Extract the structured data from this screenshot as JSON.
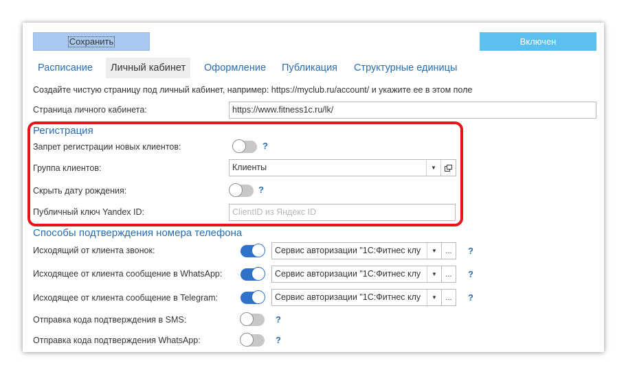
{
  "toolbar": {
    "save_label": "Сохранить",
    "status_label": "Включен"
  },
  "tabs": [
    {
      "label": "Расписание",
      "active": false
    },
    {
      "label": "Личный кабинет",
      "active": true
    },
    {
      "label": "Оформление",
      "active": false
    },
    {
      "label": "Публикация",
      "active": false
    },
    {
      "label": "Структурные единицы",
      "active": false
    }
  ],
  "note": "Создайте чистую страницу под личный кабинет, например: https://myclub.ru/account/ и укажите ее в этом поле",
  "account_page": {
    "label": "Страница личного кабинета:",
    "value": "https://www.fitness1c.ru/lk/"
  },
  "registration": {
    "title": "Регистрация",
    "ban_registration": {
      "label": "Запрет регистрации новых клиентов:",
      "on": false,
      "help": "?"
    },
    "client_group": {
      "label": "Группа клиентов:",
      "value": "Клиенты"
    },
    "hide_birthdate": {
      "label": "Скрыть дату рождения:",
      "on": false,
      "help": "?"
    },
    "yandex_key": {
      "label": "Публичный ключ Yandex ID:",
      "placeholder": "ClientID из Яндекс ID"
    }
  },
  "phone_confirmation": {
    "title": "Способы подтверждения номера телефона",
    "rows": [
      {
        "label": "Исходящий от клиента звонок:",
        "on": true,
        "service": "Сервис авторизации \"1С:Фитнес клу",
        "more": "...",
        "help": "?"
      },
      {
        "label": "Исходящее от клиента сообщение в WhatsApp:",
        "on": true,
        "service": "Сервис авторизации \"1С:Фитнес клу",
        "more": "...",
        "help": "?"
      },
      {
        "label": "Исходящее от клиента сообщение в Telegram:",
        "on": true,
        "service": "Сервис авторизации \"1С:Фитнес клу",
        "more": "...",
        "help": "?"
      },
      {
        "label": "Отправка кода подтверждения в SMS:",
        "on": false,
        "help": "?"
      },
      {
        "label": "Отправка кода подтверждения WhatsApp:",
        "on": false,
        "help": "?"
      }
    ]
  },
  "colors": {
    "accent_link": "#2a6bb0",
    "save_button": "#a9c8ef",
    "status_button": "#5bc0f0",
    "toggle_on": "#2f72c9",
    "highlight": "#e8141b"
  }
}
